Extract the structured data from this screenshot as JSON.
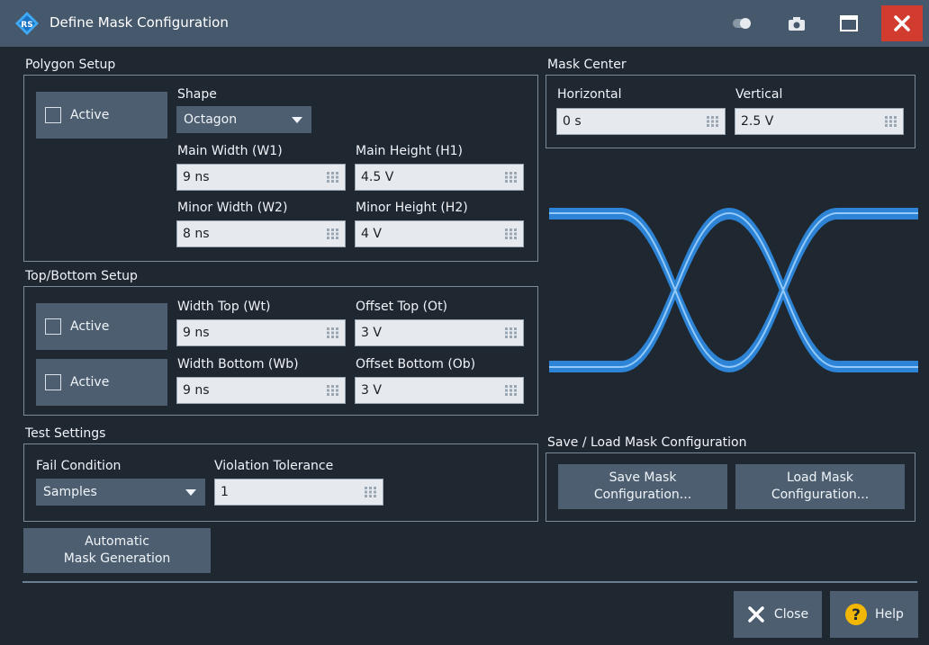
{
  "window": {
    "title": "Define Mask Configuration"
  },
  "polygon": {
    "group_label": "Polygon Setup",
    "active_label": "Active",
    "shape_label": "Shape",
    "shape_value": "Octagon",
    "main_width_label": "Main Width (W1)",
    "main_width_value": "9 ns",
    "main_height_label": "Main Height (H1)",
    "main_height_value": "4.5 V",
    "minor_width_label": "Minor Width (W2)",
    "minor_width_value": "8 ns",
    "minor_height_label": "Minor Height (H2)",
    "minor_height_value": "4 V"
  },
  "topbottom": {
    "group_label": "Top/Bottom Setup",
    "active_top_label": "Active",
    "active_bottom_label": "Active",
    "width_top_label": "Width Top (Wt)",
    "width_top_value": "9 ns",
    "offset_top_label": "Offset Top (Ot)",
    "offset_top_value": "3 V",
    "width_bottom_label": "Width Bottom (Wb)",
    "width_bottom_value": "9 ns",
    "offset_bottom_label": "Offset Bottom (Ob)",
    "offset_bottom_value": "3 V"
  },
  "test": {
    "group_label": "Test Settings",
    "fail_label": "Fail Condition",
    "fail_value": "Samples",
    "tolerance_label": "Violation Tolerance",
    "tolerance_value": "1"
  },
  "auto_mask": {
    "line1": "Automatic",
    "line2": "Mask Generation"
  },
  "mask_center": {
    "group_label": "Mask Center",
    "horizontal_label": "Horizontal",
    "horizontal_value": "0 s",
    "vertical_label": "Vertical",
    "vertical_value": "2.5 V"
  },
  "saveload": {
    "group_label": "Save / Load Mask Configuration",
    "save_line1": "Save Mask",
    "save_line2": "Configuration...",
    "load_line1": "Load Mask",
    "load_line2": "Configuration..."
  },
  "footer": {
    "close_label": "Close",
    "help_label": "Help"
  },
  "icons": [
    "rs-logo-icon",
    "toggle-icon",
    "camera-icon",
    "maximize-icon",
    "close-icon",
    "keypad-icon",
    "help-icon"
  ],
  "colors": {
    "titlebar": "#46586b",
    "close": "#d13c2f",
    "background": "#1f2731",
    "button": "#4c5e70",
    "eye": "#2f8fe8",
    "help": "#f2b705"
  }
}
